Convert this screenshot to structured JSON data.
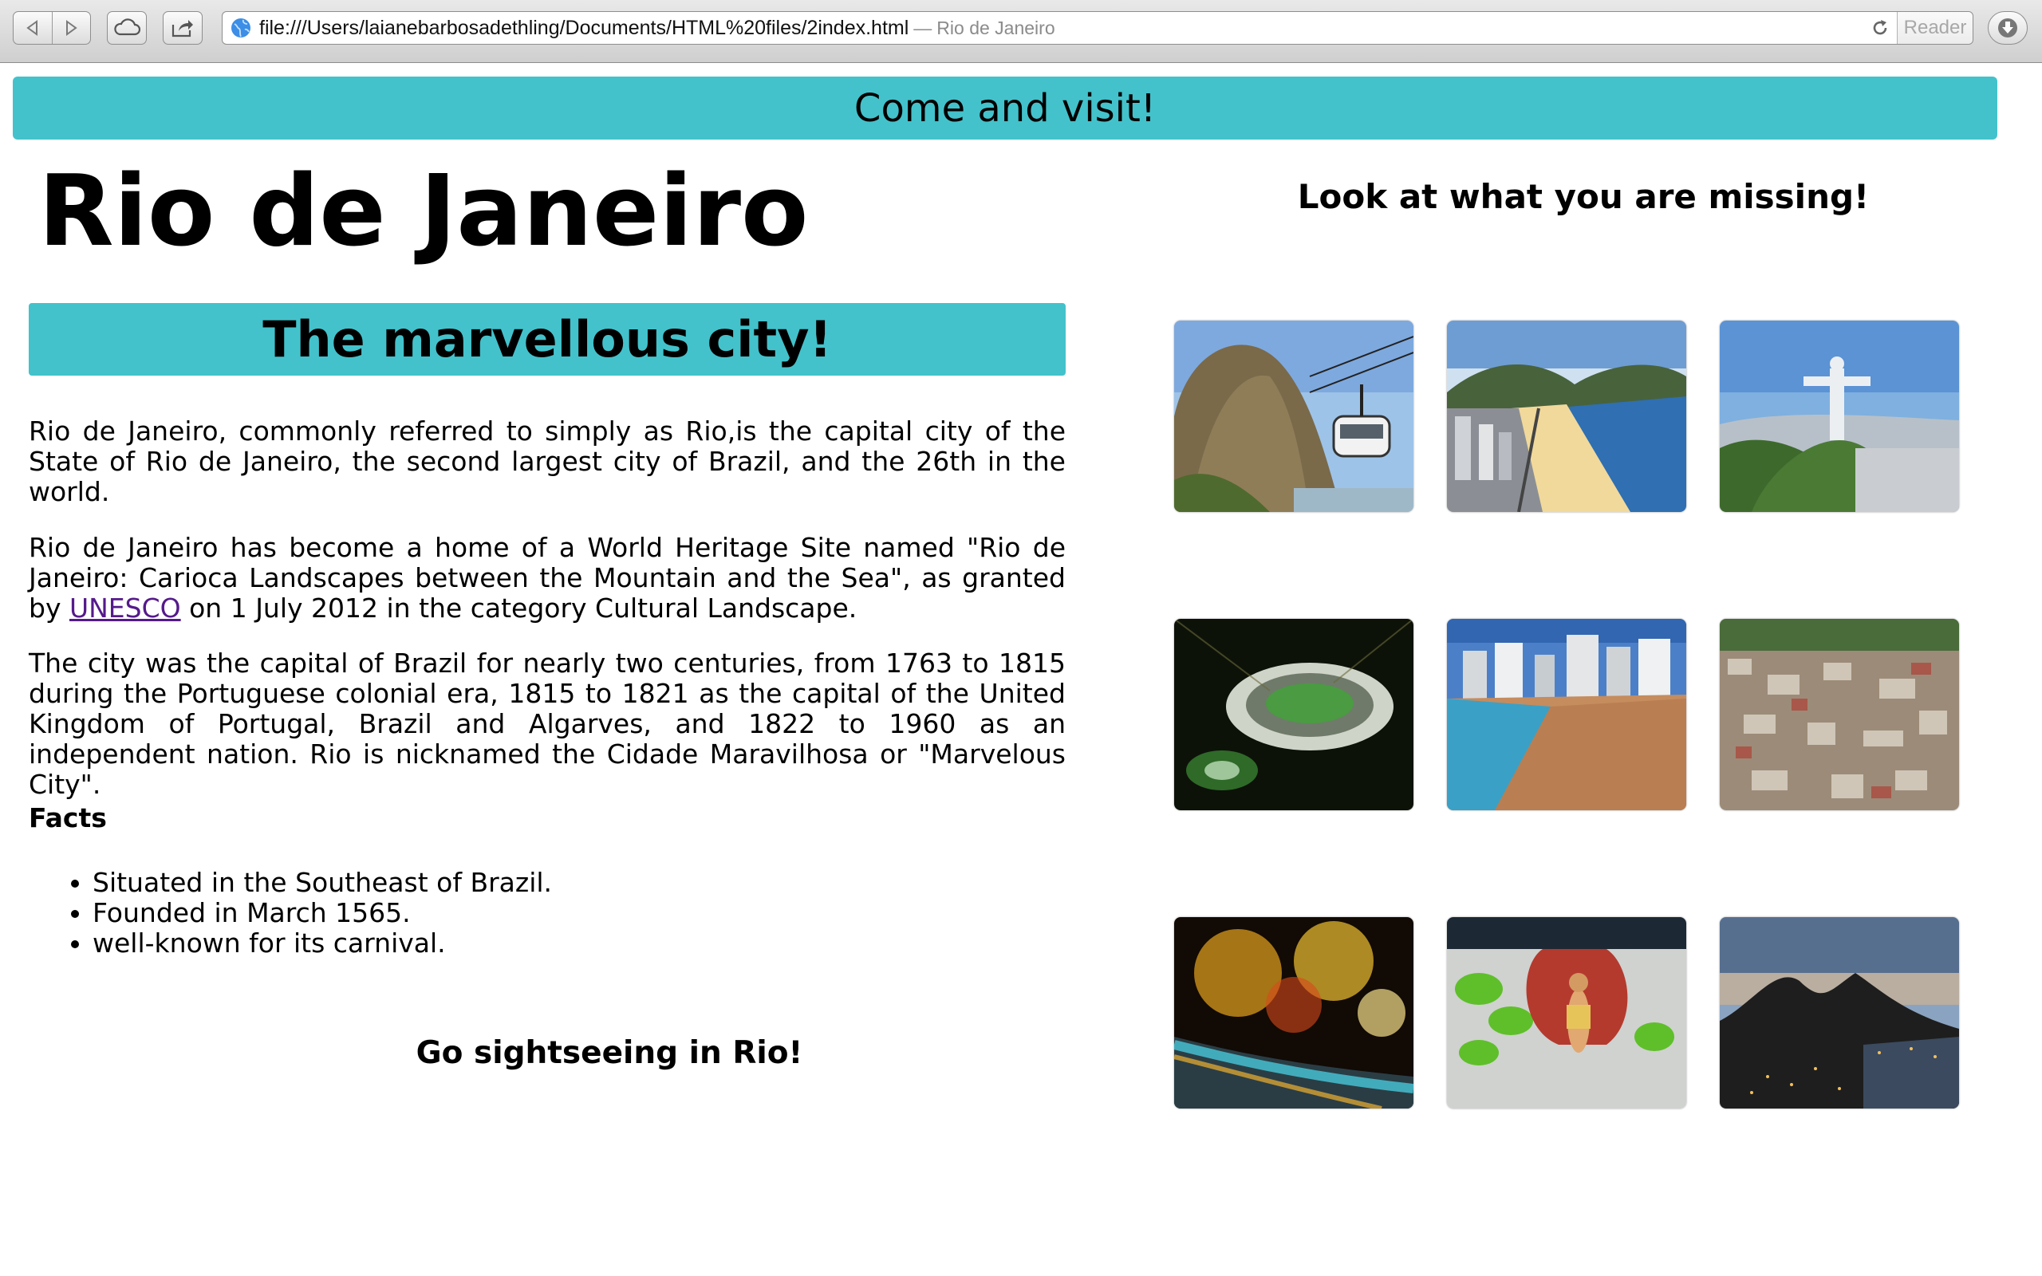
{
  "browser": {
    "url": "file:///Users/laianebarbosadethling/Documents/HTML%20files/2index.html",
    "title_separator": "—",
    "page_title": "Rio de Janeiro",
    "reader_label": "Reader"
  },
  "page": {
    "banner": "Come and visit!",
    "heading": "Rio de Janeiro",
    "subheading": "The marvellous city!",
    "paragraph1": "Rio de Janeiro, commonly referred to simply as Rio,is the capital city of the State of Rio de Janeiro, the second largest city of Brazil, and the 26th in the world.",
    "paragraph2_before": "Rio de Janeiro has become a home of a World Heritage Site named \"Rio de Janeiro: Carioca Landscapes between the Mountain and the Sea\", as granted by ",
    "paragraph2_link": "UNESCO",
    "paragraph2_after": " on 1 July 2012 in the category Cultural Landscape.",
    "paragraph3": "The city was the capital of Brazil for nearly two centuries, from 1763 to 1815 during the Portuguese colonial era, 1815 to 1821 as the capital of the United Kingdom of Portugal, Brazil and Algarves, and 1822 to 1960 as an independent nation. Rio is nicknamed the Cidade Maravilhosa or \"Marvelous City\".",
    "facts_title": "Facts",
    "facts": [
      "Situated in the Southeast of Brazil.",
      "Founded in March 1565.",
      "well-known for its carnival."
    ],
    "sightseeing": "Go sightseeing in Rio!",
    "gallery_heading": "Look at what you are missing!"
  },
  "gallery": [
    {
      "name": "sugarloaf-cable-car-photo"
    },
    {
      "name": "copacabana-beach-photo"
    },
    {
      "name": "christ-the-redeemer-photo"
    },
    {
      "name": "maracana-stadium-photo"
    },
    {
      "name": "crowded-beach-photo"
    },
    {
      "name": "favela-hillside-photo"
    },
    {
      "name": "new-year-fireworks-photo"
    },
    {
      "name": "carnival-dancer-photo"
    },
    {
      "name": "rio-night-skyline-photo"
    }
  ],
  "colors": {
    "banner": "#43c2cb",
    "link": "#551a8b"
  }
}
